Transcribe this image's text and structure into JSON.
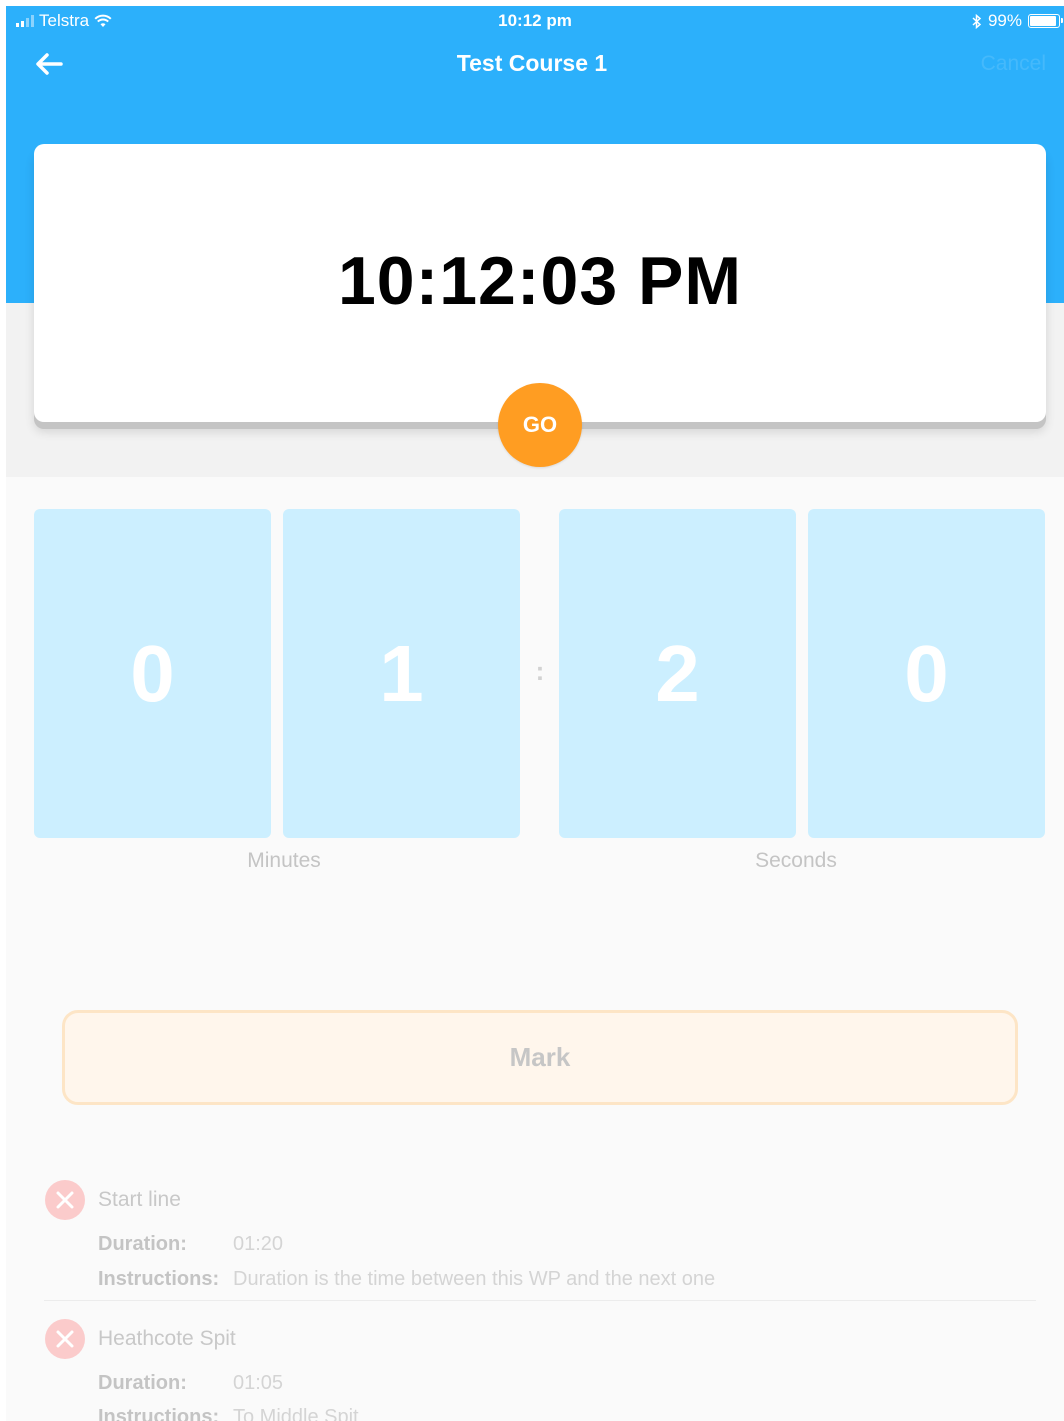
{
  "status_bar": {
    "carrier": "Telstra",
    "time": "10:12 pm",
    "battery": "99%"
  },
  "nav": {
    "title": "Test Course 1",
    "cancel_label": "Cancel",
    "back_icon": "arrow-left-icon"
  },
  "clock": {
    "time": "10:12:03 PM",
    "go_label": "GO"
  },
  "timer": {
    "minutes_digits": [
      "0",
      "1"
    ],
    "separator": ":",
    "seconds_digits": [
      "2",
      "0"
    ],
    "minutes_label": "Minutes",
    "seconds_label": "Seconds"
  },
  "mark_label": "Mark",
  "waypoints": [
    {
      "name": "Start line",
      "duration_label": "Duration:",
      "duration": "01:20",
      "instructions_label": "Instructions:",
      "instructions": "Duration is the time between this WP and the next one"
    },
    {
      "name": "Heathcote Spit",
      "duration_label": "Duration:",
      "duration": "01:05",
      "instructions_label": "Instructions:",
      "instructions": "To Middle Spit"
    }
  ],
  "colors": {
    "header": "#2cb0fb",
    "go_button": "#ff9d22",
    "digit_tile": "#ccefff",
    "waypoint_icon": "#fbcbcb"
  }
}
